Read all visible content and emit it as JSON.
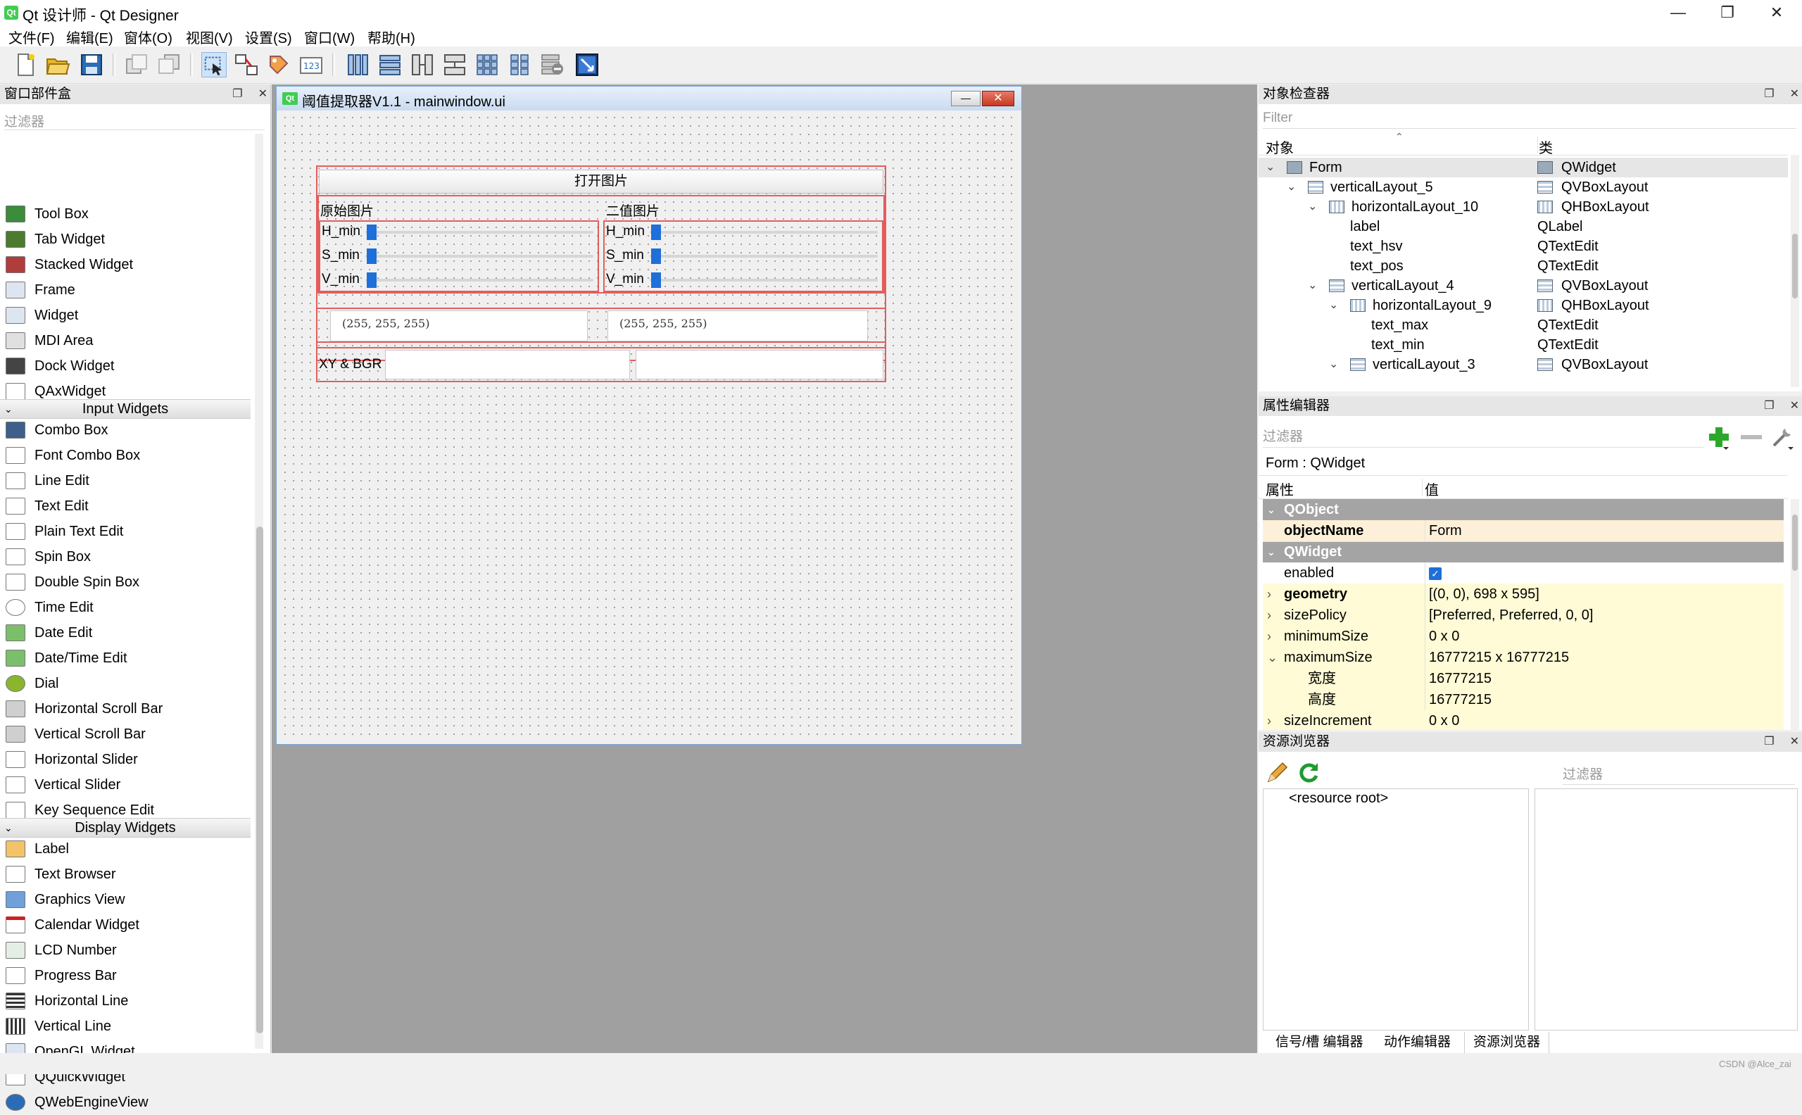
{
  "window": {
    "title": "Qt 设计师 - Qt Designer",
    "app_icon": "Qt"
  },
  "menubar": [
    "文件(F)",
    "编辑(E)",
    "窗体(O)",
    "视图(V)",
    "设置(S)",
    "窗口(W)",
    "帮助(H)"
  ],
  "widget_box": {
    "title": "窗口部件盒",
    "filter_placeholder": "过滤器",
    "items_top": [
      "Tool Box",
      "Tab Widget",
      "Stacked Widget",
      "Frame",
      "Widget",
      "MDI Area",
      "Dock Widget",
      "QAxWidget"
    ],
    "cat_input": "Input Widgets",
    "items_input": [
      "Combo Box",
      "Font Combo Box",
      "Line Edit",
      "Text Edit",
      "Plain Text Edit",
      "Spin Box",
      "Double Spin Box",
      "Time Edit",
      "Date Edit",
      "Date/Time Edit",
      "Dial",
      "Horizontal Scroll Bar",
      "Vertical Scroll Bar",
      "Horizontal Slider",
      "Vertical Slider",
      "Key Sequence Edit"
    ],
    "cat_display": "Display Widgets",
    "items_display": [
      "Label",
      "Text Browser",
      "Graphics View",
      "Calendar Widget",
      "LCD Number",
      "Progress Bar",
      "Horizontal Line",
      "Vertical Line",
      "OpenGL Widget",
      "QQuickWidget",
      "QWebEngineView"
    ]
  },
  "subwindow": {
    "icon": "Qt",
    "title": "阈值提取器V1.1 - mainwindow.ui",
    "open_button": "打开图片",
    "left_label": "原始图片",
    "right_label": "二值图片",
    "slider_labels": [
      "H_min",
      "S_min",
      "V_min"
    ],
    "left_text": "(255, 255, 255)",
    "right_text": "(255, 255, 255)",
    "xy_label": "XY & BGR"
  },
  "object_inspector": {
    "title": "对象检查器",
    "filter_placeholder": "Filter",
    "col_object": "对象",
    "col_class": "类",
    "rows": [
      {
        "name": "Form",
        "cls": "QWidget"
      },
      {
        "name": "verticalLayout_5",
        "cls": "QVBoxLayout"
      },
      {
        "name": "horizontalLayout_10",
        "cls": "QHBoxLayout"
      },
      {
        "name": "label",
        "cls": "QLabel"
      },
      {
        "name": "text_hsv",
        "cls": "QTextEdit"
      },
      {
        "name": "text_pos",
        "cls": "QTextEdit"
      },
      {
        "name": "verticalLayout_4",
        "cls": "QVBoxLayout"
      },
      {
        "name": "horizontalLayout_9",
        "cls": "QHBoxLayout"
      },
      {
        "name": "text_max",
        "cls": "QTextEdit"
      },
      {
        "name": "text_min",
        "cls": "QTextEdit"
      },
      {
        "name": "verticalLayout_3",
        "cls": "QVBoxLayout"
      }
    ]
  },
  "property_editor": {
    "title": "属性编辑器",
    "filter_placeholder": "过滤器",
    "context": "Form : QWidget",
    "col_prop": "属性",
    "col_value": "值",
    "group_qobject": "QObject",
    "group_qwidget": "QWidget",
    "rows": [
      {
        "name": "objectName",
        "value": "Form"
      },
      {
        "name": "enabled",
        "value": ""
      },
      {
        "name": "geometry",
        "value": "[(0, 0), 698 x 595]"
      },
      {
        "name": "sizePolicy",
        "value": "[Preferred, Preferred, 0, 0]"
      },
      {
        "name": "minimumSize",
        "value": "0 x 0"
      },
      {
        "name": "maximumSize",
        "value": "16777215 x 16777215"
      },
      {
        "name": "宽度",
        "value": "16777215"
      },
      {
        "name": "高度",
        "value": "16777215"
      }
    ],
    "partial_row": {
      "name": "sizeIncrement",
      "value": "0 x 0"
    }
  },
  "resource_browser": {
    "title": "资源浏览器",
    "filter_placeholder": "过滤器",
    "root": "<resource root>"
  },
  "bottom_tabs": [
    "信号/槽 编辑器",
    "动作编辑器",
    "资源浏览器"
  ],
  "watermark": "CSDN @Alce_zai",
  "colors": {
    "selection_red": "#e35d5d",
    "slider_blue": "#1e6fd9",
    "group_gray": "#a4a4a4"
  }
}
